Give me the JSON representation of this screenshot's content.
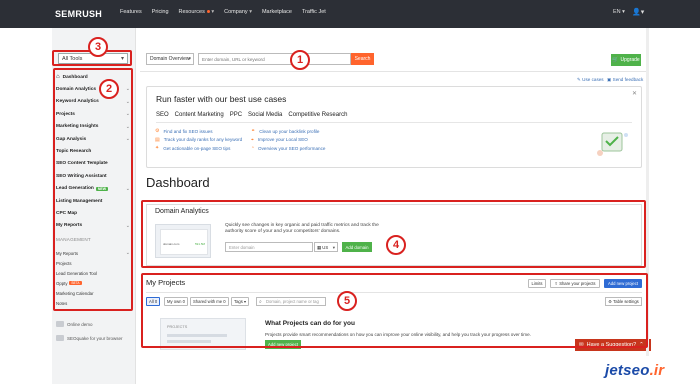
{
  "topbar": {
    "logo_text": "SEMRUSH",
    "nav": [
      "Features",
      "Pricing",
      "Resources",
      "Company",
      "Marketplace",
      "Traffic Jet"
    ],
    "lang": "EN",
    "user_icon": "user-icon"
  },
  "sidebar": {
    "tools_select": "All Tools",
    "items": [
      {
        "label": "Dashboard",
        "chev": false,
        "icon": "home-icon"
      },
      {
        "label": "Domain Analytics",
        "chev": true
      },
      {
        "label": "Keyword Analytics",
        "chev": true
      },
      {
        "label": "Projects",
        "chev": true
      },
      {
        "label": "Marketing Insights",
        "chev": true
      },
      {
        "label": "Gap Analysis",
        "chev": true
      },
      {
        "label": "Topic Research",
        "chev": false
      },
      {
        "label": "SEO Content Template",
        "chev": false
      },
      {
        "label": "SEO Writing Assistant",
        "chev": false
      },
      {
        "label": "Lead Generation",
        "chev": true,
        "badge": "NEW"
      },
      {
        "label": "Listing Management",
        "chev": false
      },
      {
        "label": "CPC Map",
        "chev": false
      },
      {
        "label": "My Reports",
        "chev": true
      }
    ],
    "management_label": "MANAGEMENT",
    "management": [
      {
        "label": "My Reports",
        "chev": true
      },
      {
        "label": "Projects"
      },
      {
        "label": "Lead Generation Tool"
      },
      {
        "label": "Oppty",
        "badge": "BETA"
      },
      {
        "label": "Marketing Calendar"
      },
      {
        "label": "Notes"
      }
    ],
    "extras": [
      "Online demo",
      "SEOquake for your browser"
    ]
  },
  "search": {
    "scope": "Domain Overview",
    "placeholder": "Enter domain, URL or keyword",
    "button": "Search"
  },
  "upgrade": "Upgrade",
  "header_links": {
    "use_cases": "Use cases",
    "feedback": "Send feedback"
  },
  "use_cases": {
    "title": "Run faster with our best use cases",
    "tabs": [
      "SEO",
      "Content Marketing",
      "PPC",
      "Social Media",
      "Competitive Research"
    ],
    "left_links": [
      "Find and fix SEO issues",
      "Track your daily ranks for any keyword",
      "Get actionable on-page SEO tips"
    ],
    "right_links": [
      "Clean up your backlink profile",
      "Improve your Local SEO",
      "Overview your SEO performance"
    ]
  },
  "dashboard_title": "Dashboard",
  "domain_analytics": {
    "title": "Domain Analytics",
    "thumb_domain": "domain.com",
    "thumb_value": "591.5M",
    "desc": "Quickly see changes in key organic and paid traffic metrics and track the authority score of your and your competitors' domains.",
    "input_placeholder": "Enter domain",
    "db": "US",
    "add_button": "Add domain"
  },
  "projects": {
    "title": "My Projects",
    "buttons": {
      "limits": "Limits",
      "share": "Share your projects",
      "add": "Add new project"
    },
    "filters": [
      "All",
      "My own",
      "Shared with me",
      "Tags"
    ],
    "filter_counts": [
      "0",
      "0",
      "0",
      ""
    ],
    "search_placeholder": "Domain, project name or tag",
    "table_settings": "Table settings",
    "illus_label": "PROJECTS",
    "what_title": "What Projects can do for you",
    "what_desc": "Projects provide smart recommendations on how you can improve your online visibility, and help you track your progress over time.",
    "add_button": "Add new project"
  },
  "suggestion": "Have a Suggestion?",
  "annotations": [
    "1",
    "2",
    "3",
    "4",
    "5"
  ],
  "watermark": {
    "main": "jetseo",
    "tld": ".ir"
  },
  "colors": {
    "accent": "#ff642d",
    "annot": "#d9211f",
    "green": "#4fb24a",
    "blue": "#2e6bd4"
  }
}
